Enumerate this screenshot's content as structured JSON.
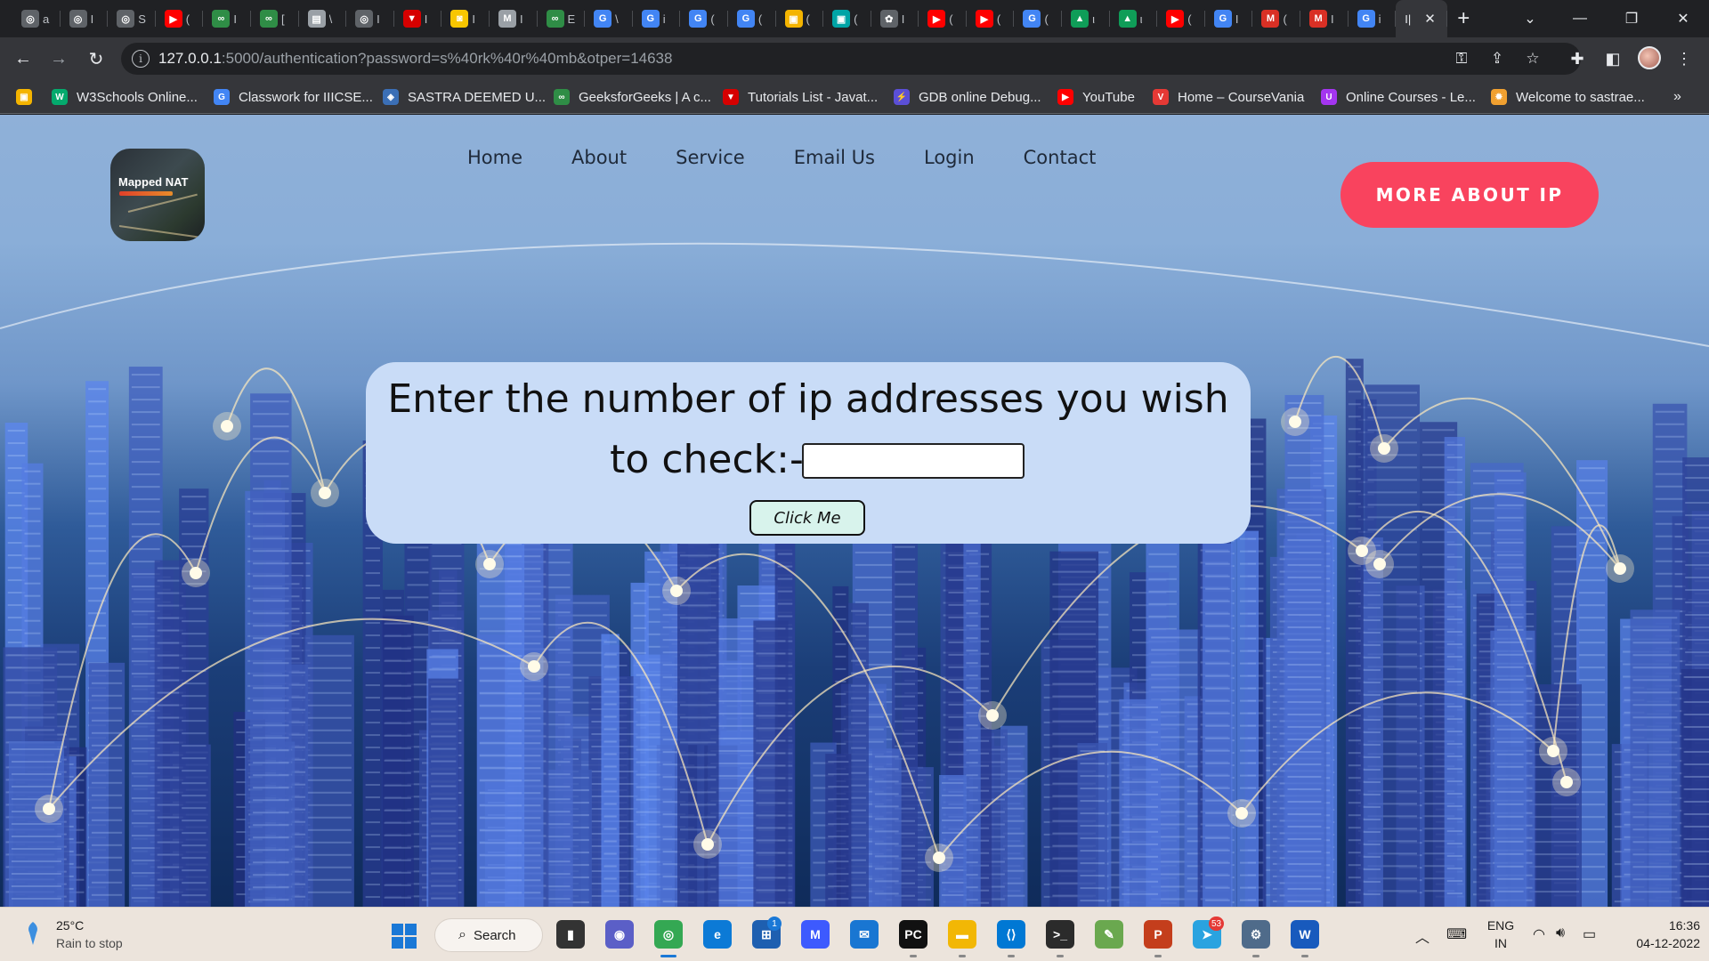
{
  "browser": {
    "tabs": [
      {
        "icon": "globe-icon",
        "color": "#5f6368",
        "glyph": "◎",
        "text": "a"
      },
      {
        "icon": "globe-icon",
        "color": "#5f6368",
        "glyph": "◎",
        "text": "I"
      },
      {
        "icon": "globe-icon",
        "color": "#5f6368",
        "glyph": "◎",
        "text": "S"
      },
      {
        "icon": "youtube-icon",
        "color": "#ff0000",
        "glyph": "▶",
        "text": "("
      },
      {
        "icon": "geeksforgeeks-icon",
        "color": "#2f8d46",
        "glyph": "∞",
        "text": "I"
      },
      {
        "icon": "geeksforgeeks-icon",
        "color": "#2f8d46",
        "glyph": "∞",
        "text": "["
      },
      {
        "icon": "document-icon",
        "color": "#9aa0a6",
        "glyph": "▤",
        "text": "\\"
      },
      {
        "icon": "globe-icon",
        "color": "#5f6368",
        "glyph": "◎",
        "text": "I"
      },
      {
        "icon": "tutorials-icon",
        "color": "#d60000",
        "glyph": "▼",
        "text": "I"
      },
      {
        "icon": "app-icon",
        "color": "#f7c600",
        "glyph": "◙",
        "text": "I"
      },
      {
        "icon": "m-icon",
        "color": "#9aa0a6",
        "glyph": "M",
        "text": "I"
      },
      {
        "icon": "geeksforgeeks-icon",
        "color": "#2f8d46",
        "glyph": "∞",
        "text": "E"
      },
      {
        "icon": "google-icon",
        "color": "#4285f4",
        "glyph": "G",
        "text": "\\"
      },
      {
        "icon": "google-icon",
        "color": "#4285f4",
        "glyph": "G",
        "text": "i"
      },
      {
        "icon": "google-icon",
        "color": "#4285f4",
        "glyph": "G",
        "text": "("
      },
      {
        "icon": "google-icon",
        "color": "#4285f4",
        "glyph": "G",
        "text": "("
      },
      {
        "icon": "classroom-icon",
        "color": "#f4b400",
        "glyph": "▣",
        "text": "("
      },
      {
        "icon": "classroom-icon",
        "color": "#00a4a6",
        "glyph": "▣",
        "text": "("
      },
      {
        "icon": "chatgpt-icon",
        "color": "#5f6368",
        "glyph": "✿",
        "text": "I"
      },
      {
        "icon": "youtube-icon",
        "color": "#ff0000",
        "glyph": "▶",
        "text": "("
      },
      {
        "icon": "youtube-icon",
        "color": "#ff0000",
        "glyph": "▶",
        "text": "("
      },
      {
        "icon": "google-icon",
        "color": "#4285f4",
        "glyph": "G",
        "text": "("
      },
      {
        "icon": "drive-icon",
        "color": "#0f9d58",
        "glyph": "▲",
        "text": "ι"
      },
      {
        "icon": "drive-icon",
        "color": "#0f9d58",
        "glyph": "▲",
        "text": "ι"
      },
      {
        "icon": "youtube-icon",
        "color": "#ff0000",
        "glyph": "▶",
        "text": "("
      },
      {
        "icon": "google-icon",
        "color": "#4285f4",
        "glyph": "G",
        "text": "I"
      },
      {
        "icon": "gmail-icon",
        "color": "#d93025",
        "glyph": "M",
        "text": "("
      },
      {
        "icon": "gmail-icon",
        "color": "#d93025",
        "glyph": "M",
        "text": "I"
      },
      {
        "icon": "google-icon",
        "color": "#4285f4",
        "glyph": "G",
        "text": "i"
      }
    ],
    "active_tab": {
      "text": "I|",
      "close": "✕"
    },
    "new_tab": "+",
    "window": {
      "dropdown": "⌄",
      "minimize": "—",
      "restore": "❐",
      "close": "✕"
    },
    "url": {
      "host": "127.0.0.1",
      "rest": ":5000/authentication?password=s%40rk%40r%40mb&otper=14638"
    },
    "bookmarks": [
      {
        "icon": "classroom-icon",
        "color": "#f4b400",
        "glyph": "▣",
        "label": ""
      },
      {
        "icon": "w3schools-icon",
        "color": "#04aa6d",
        "glyph": "W",
        "label": "W3Schools Online..."
      },
      {
        "icon": "google-icon",
        "color": "#4285f4",
        "glyph": "G",
        "label": "Classwork for IIICSE..."
      },
      {
        "icon": "sastra-icon",
        "color": "#3b6fb6",
        "glyph": "◈",
        "label": "SASTRA DEEMED U..."
      },
      {
        "icon": "geeksforgeeks-icon",
        "color": "#2f8d46",
        "glyph": "∞",
        "label": "GeeksforGeeks | A c..."
      },
      {
        "icon": "tutorials-icon",
        "color": "#d60000",
        "glyph": "▼",
        "label": "Tutorials List - Javat..."
      },
      {
        "icon": "gdb-icon",
        "color": "#5b4fd6",
        "glyph": "⚡",
        "label": "GDB online Debug..."
      },
      {
        "icon": "youtube-icon",
        "color": "#ff0000",
        "glyph": "▶",
        "label": "YouTube"
      },
      {
        "icon": "coursevania-icon",
        "color": "#e53935",
        "glyph": "V",
        "label": "Home – CourseVania"
      },
      {
        "icon": "udemy-icon",
        "color": "#a435f0",
        "glyph": "U",
        "label": "Online Courses - Le..."
      },
      {
        "icon": "sastra-sun-icon",
        "color": "#f0a030",
        "glyph": "✹",
        "label": "Welcome to sastrae..."
      }
    ],
    "bookmarks_more": "»"
  },
  "page": {
    "logo": {
      "text": "Mapped NAT"
    },
    "menu": [
      "Home",
      "About",
      "Service",
      "Email Us",
      "Login",
      "Contact"
    ],
    "cta": "MORE ABOUT IP",
    "form": {
      "prompt_line1": "Enter the number of ip addresses you wish",
      "prompt_line2": "to check:-",
      "input_value": "",
      "button": "Click Me"
    }
  },
  "taskbar": {
    "weather": {
      "temp": "25°C",
      "desc": "Rain to stop"
    },
    "search": "Search",
    "apps": [
      {
        "icon": "task-view-icon",
        "color": "#333333",
        "glyph": "▮",
        "running": false
      },
      {
        "icon": "chat-icon",
        "color": "#5b5fc7",
        "glyph": "◉",
        "running": false
      },
      {
        "icon": "chrome-icon",
        "color": "#34a853",
        "glyph": "◎",
        "running": true
      },
      {
        "icon": "edge-icon",
        "color": "#0c7ad6",
        "glyph": "e",
        "running": false
      },
      {
        "icon": "store-icon",
        "color": "#1e5fb0",
        "glyph": "⊞",
        "running": false
      },
      {
        "icon": "mathway-icon",
        "color": "#3d5afe",
        "glyph": "M",
        "running": false
      },
      {
        "icon": "mail-icon",
        "color": "#1976d2",
        "glyph": "✉",
        "running": false
      },
      {
        "icon": "pycharm-icon",
        "color": "#111111",
        "glyph": "PC",
        "running": true
      },
      {
        "icon": "file-explorer-icon",
        "color": "#f2b705",
        "glyph": "▬",
        "running": true
      },
      {
        "icon": "vscode-icon",
        "color": "#0078d4",
        "glyph": "⟨⟩",
        "running": true
      },
      {
        "icon": "terminal-icon",
        "color": "#2b2b2b",
        "glyph": ">_",
        "running": true
      },
      {
        "icon": "paint-icon",
        "color": "#6aa84f",
        "glyph": "✎",
        "running": false
      },
      {
        "icon": "powerpoint-icon",
        "color": "#c43e1c",
        "glyph": "P",
        "running": true
      },
      {
        "icon": "telegram-icon",
        "color": "#2aa3e0",
        "glyph": "➤",
        "running": false
      },
      {
        "icon": "settings-icon",
        "color": "#4f6b8a",
        "glyph": "⚙",
        "running": true
      },
      {
        "icon": "word-icon",
        "color": "#185abd",
        "glyph": "W",
        "running": true
      }
    ],
    "store_badge": "1",
    "telegram_badge": "53",
    "tray": {
      "lang": "ENG",
      "region": "IN",
      "time": "16:36",
      "date": "04-12-2022"
    }
  }
}
